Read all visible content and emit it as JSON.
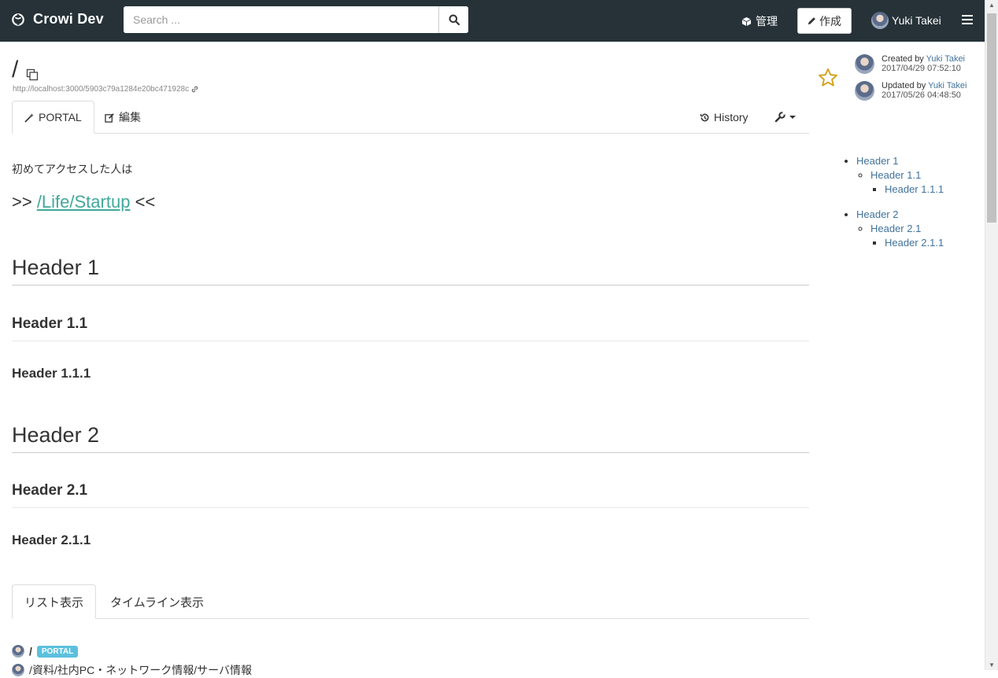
{
  "navbar": {
    "brand": "Crowi Dev",
    "search_placeholder": "Search ...",
    "admin_label": "管理",
    "create_label": "作成",
    "user_name": "Yuki Takei"
  },
  "page": {
    "title": "/",
    "url": "http://localhost:3000/5903c79a1284e20bc471928c",
    "tabs": {
      "portal": "PORTAL",
      "edit": "編集",
      "history": "History"
    }
  },
  "content": {
    "intro": "初めてアクセスした人は",
    "startup_prefix": ">> ",
    "startup_link": "/Life/Startup",
    "startup_suffix": " <<",
    "headers": {
      "h1": "Header 1",
      "h1_1": "Header 1.1",
      "h1_1_1": "Header 1.1.1",
      "h2": "Header 2",
      "h2_1": "Header 2.1",
      "h2_1_1": "Header 2.1.1"
    },
    "list_tabs": {
      "list": "リスト表示",
      "timeline": "タイムライン表示"
    },
    "pages": [
      {
        "path": "/",
        "badge": "PORTAL"
      },
      {
        "path": "/資料/社内PC・ネットワーク情報/サーバ情報"
      }
    ]
  },
  "sidebar": {
    "created_prefix": "Created by ",
    "created_user": "Yuki Takei",
    "created_at": "2017/04/29 07:52:10",
    "updated_prefix": "Updated by ",
    "updated_user": "Yuki Takei",
    "updated_at": "2017/05/26 04:48:50",
    "toc": {
      "h1": "Header 1",
      "h1_1": "Header 1.1",
      "h1_1_1": "Header 1.1.1",
      "h2": "Header 2",
      "h2_1": "Header 2.1",
      "h2_1_1": "Header 2.1.1"
    }
  },
  "colors": {
    "navbar": "#263238",
    "link": "#41a89b",
    "badge": "#5bc0de",
    "star": "#d4a017"
  }
}
